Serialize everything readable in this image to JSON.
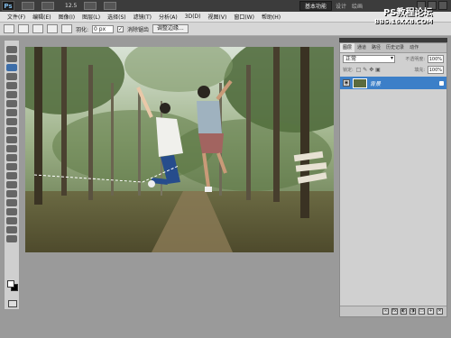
{
  "appbar": {
    "logo": "Ps",
    "zoom": "12.5",
    "workspace_active": "基本功能",
    "workspace_links": [
      "设计",
      "绘画"
    ]
  },
  "watermark": {
    "line1": "PS教程论坛",
    "line2": "BBS.16XX8.COM"
  },
  "menu": [
    "文件(F)",
    "编辑(E)",
    "图像(I)",
    "图层(L)",
    "选择(S)",
    "滤镜(T)",
    "分析(A)",
    "3D(D)",
    "视图(V)",
    "窗口(W)",
    "帮助(H)"
  ],
  "options": {
    "feather_label": "羽化:",
    "feather_value": "0 px",
    "antialias_label": "消除锯齿",
    "antialias_checked": "✓",
    "refine_edge": "调整边缘..."
  },
  "layers_panel": {
    "tabs": [
      "图层",
      "通道",
      "路径",
      "历史记录",
      "动作"
    ],
    "blend_mode": "正常",
    "opacity_label": "不透明度:",
    "opacity_value": "100%",
    "lock_label": "锁定:",
    "fill_label": "填充:",
    "fill_value": "100%",
    "layer_name": "背景"
  },
  "icons": {
    "app_logo": "photoshop-logo-icon",
    "eye": "visibility-eye-icon",
    "lock": "lock-icon"
  },
  "colors": {
    "selection_blue": "#3c7fc8",
    "appbar_dark": "#3c3c3c"
  }
}
